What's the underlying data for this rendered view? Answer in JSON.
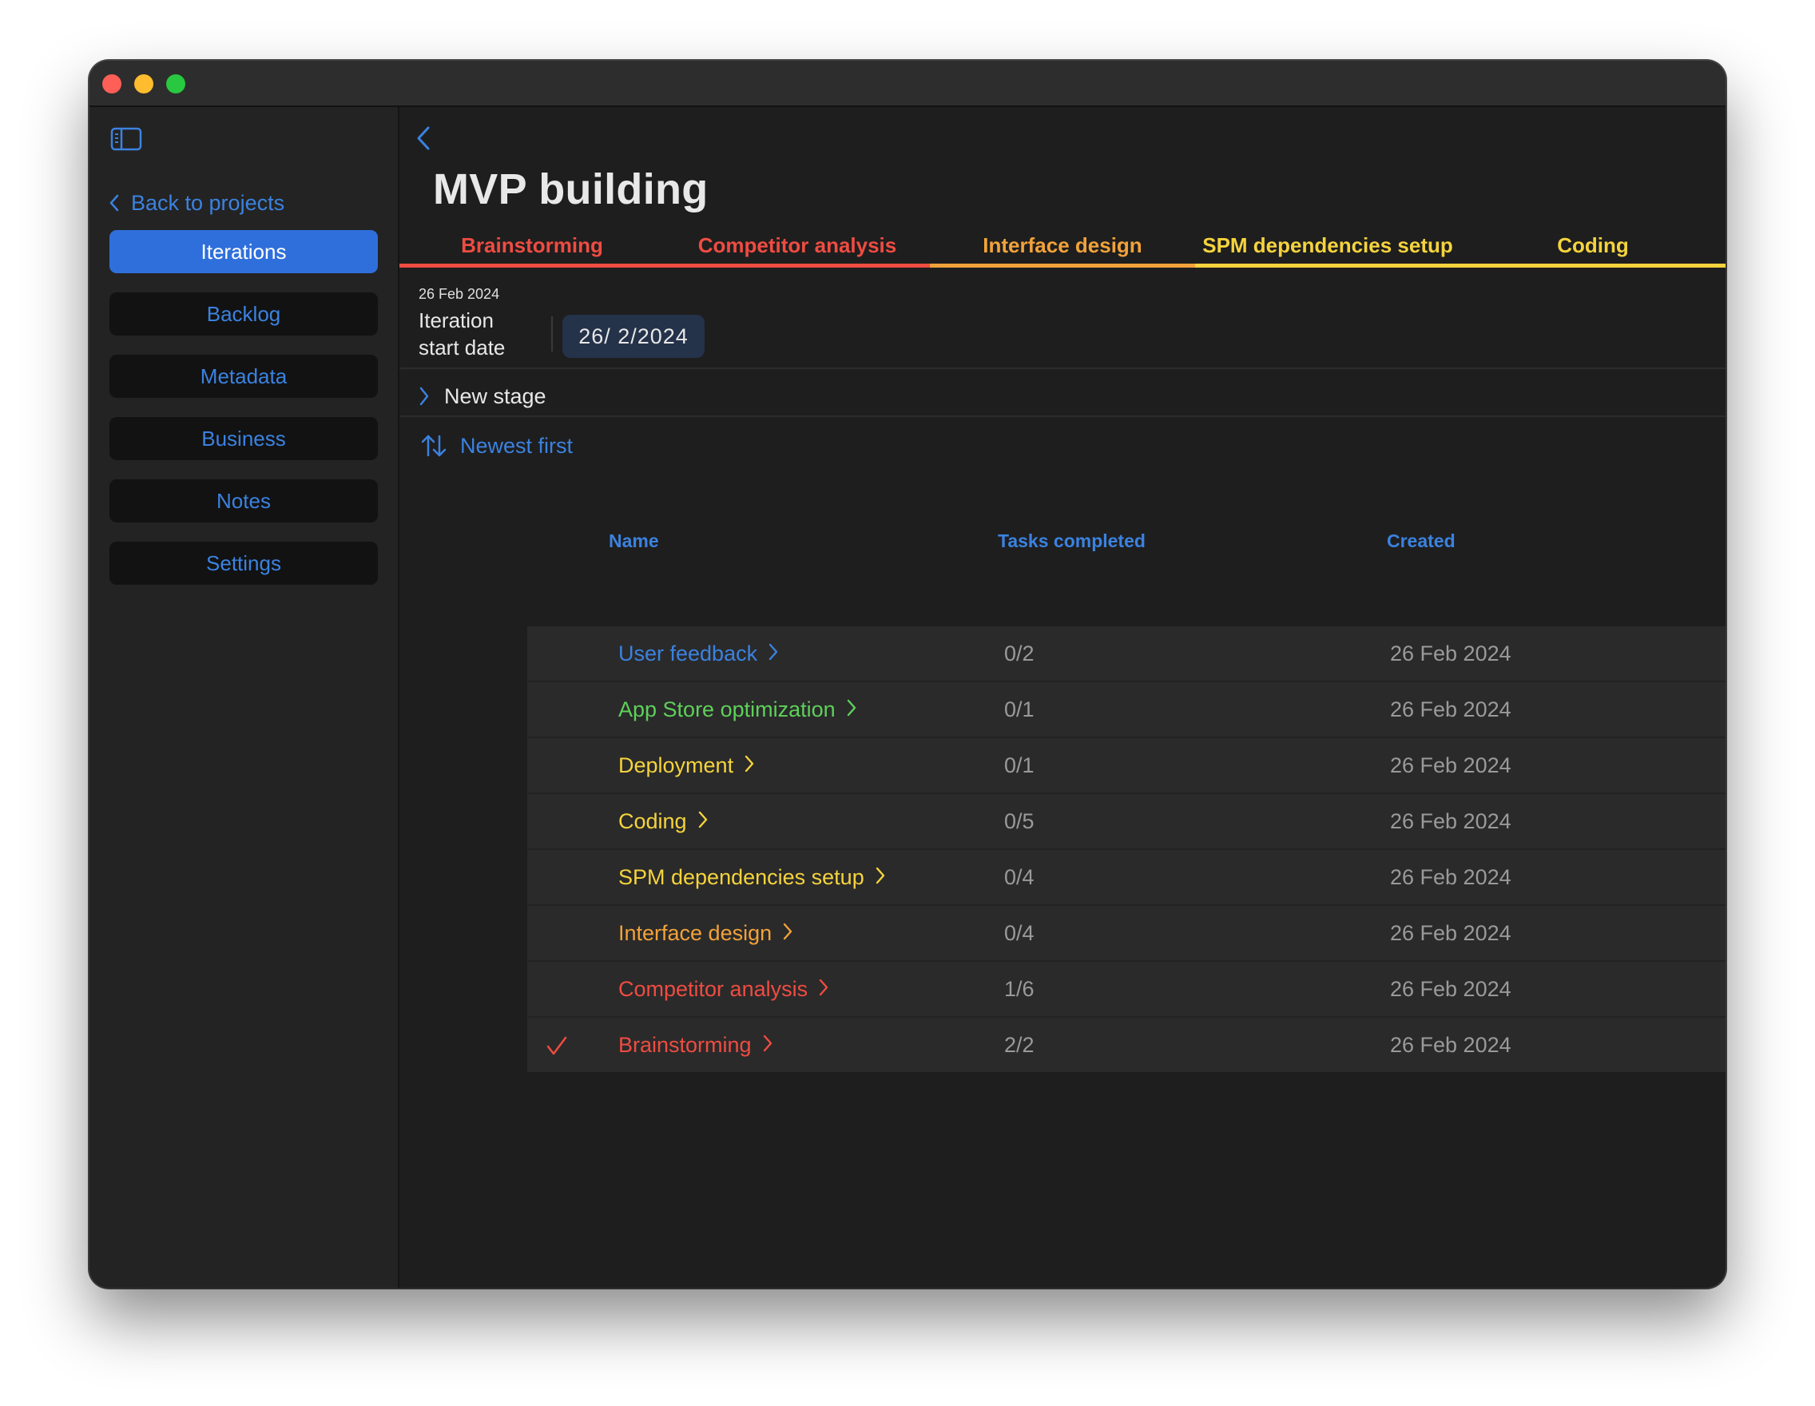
{
  "colors": {
    "accent": "#3b82e0",
    "active_nav_bg": "#2f6fdb",
    "red": "#ef4c42",
    "orange": "#f2a23a",
    "yellow": "#f5d33d",
    "green": "#5ed05a",
    "blue": "#3b82e0"
  },
  "sidebar": {
    "toggle_icon": "sidebar-icon",
    "back_label": "Back to projects",
    "items": [
      {
        "label": "Iterations",
        "active": true
      },
      {
        "label": "Backlog",
        "active": false
      },
      {
        "label": "Metadata",
        "active": false
      },
      {
        "label": "Business",
        "active": false
      },
      {
        "label": "Notes",
        "active": false
      },
      {
        "label": "Settings",
        "active": false
      }
    ]
  },
  "main": {
    "title": "MVP building",
    "tabs": [
      {
        "label": "Brainstorming",
        "color": "#ef4c42"
      },
      {
        "label": "Competitor analysis",
        "color": "#ef4c42"
      },
      {
        "label": "Interface design",
        "color": "#f2a23a"
      },
      {
        "label": "SPM dependencies setup",
        "color": "#f5d33d"
      },
      {
        "label": "Coding",
        "color": "#f5d33d"
      }
    ],
    "date_caption": "26 Feb 2024",
    "iteration_label_line1": "Iteration",
    "iteration_label_line2": "start date",
    "date_value": "26/  2/2024",
    "new_stage_label": "New stage",
    "sort_label": "Newest first",
    "columns": {
      "name": "Name",
      "tasks": "Tasks completed",
      "created": "Created"
    },
    "rows": [
      {
        "name": "User feedback",
        "tasks": "0/2",
        "created": "26 Feb 2024",
        "color": "#3b82e0",
        "completed": false
      },
      {
        "name": "App Store optimization",
        "tasks": "0/1",
        "created": "26 Feb 2024",
        "color": "#5ed05a",
        "completed": false
      },
      {
        "name": "Deployment",
        "tasks": "0/1",
        "created": "26 Feb 2024",
        "color": "#f5d33d",
        "completed": false
      },
      {
        "name": "Coding",
        "tasks": "0/5",
        "created": "26 Feb 2024",
        "color": "#f5d33d",
        "completed": false
      },
      {
        "name": "SPM dependencies setup",
        "tasks": "0/4",
        "created": "26 Feb 2024",
        "color": "#f5d33d",
        "completed": false
      },
      {
        "name": "Interface design",
        "tasks": "0/4",
        "created": "26 Feb 2024",
        "color": "#f2a23a",
        "completed": false
      },
      {
        "name": "Competitor analysis",
        "tasks": "1/6",
        "created": "26 Feb 2024",
        "color": "#ef4c42",
        "completed": false
      },
      {
        "name": "Brainstorming",
        "tasks": "2/2",
        "created": "26 Feb 2024",
        "color": "#ef4c42",
        "completed": true
      }
    ]
  }
}
